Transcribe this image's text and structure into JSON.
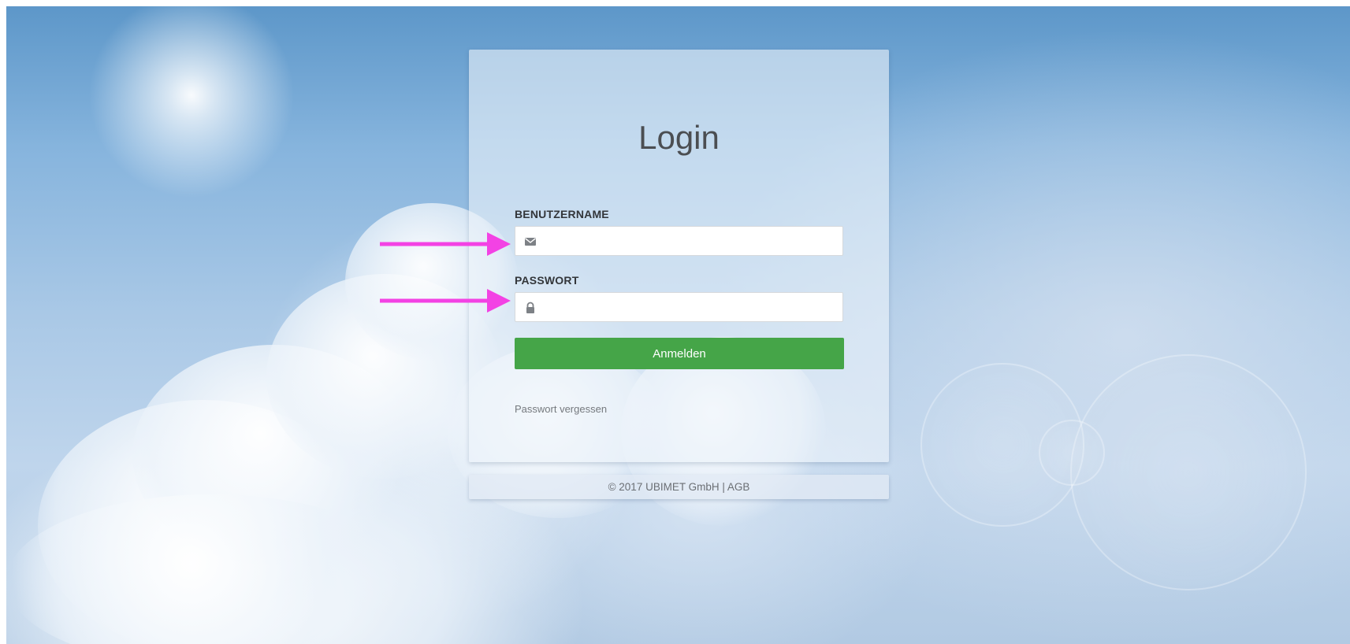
{
  "login": {
    "title": "Login",
    "username_label": "BENUTZERNAME",
    "username_value": "",
    "password_label": "PASSWORT",
    "password_value": "",
    "submit_label": "Anmelden",
    "forgot_link": "Passwort vergessen"
  },
  "footer": {
    "copyright": "© 2017 UBIMET GmbH",
    "separator": "|",
    "terms_link": "AGB"
  },
  "icons": {
    "username_icon": "envelope-icon",
    "password_icon": "lock-icon",
    "annotation_arrow": "arrow-right-icon"
  },
  "colors": {
    "submit_button": "#45a548",
    "annotation_arrow": "#f342e4",
    "title_text": "#4b4e52"
  }
}
